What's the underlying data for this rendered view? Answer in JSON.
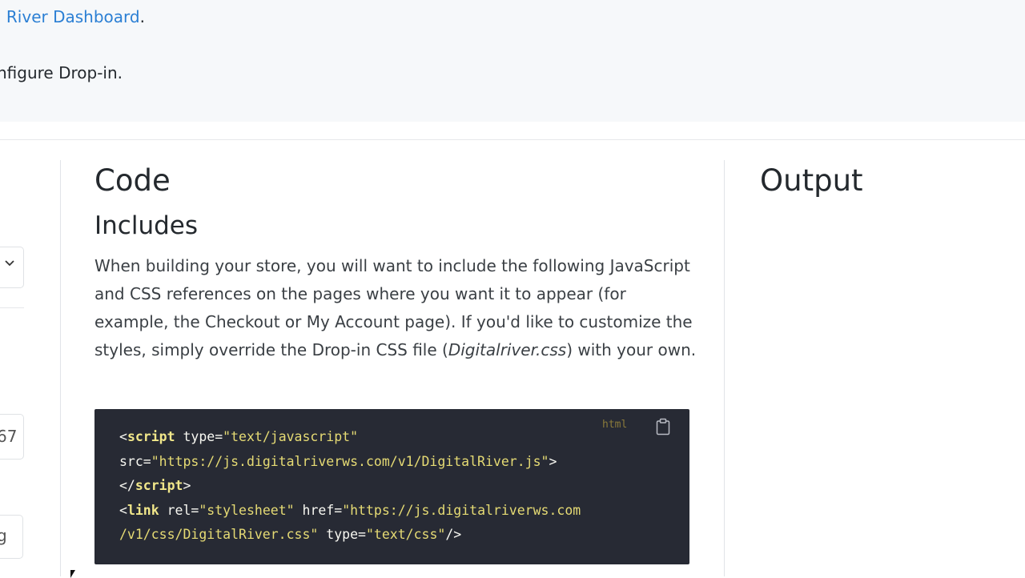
{
  "top": {
    "link_text": "l River Dashboard",
    "link_suffix": ".",
    "line2": "nfigure Drop-in."
  },
  "left_controls": {
    "fragment_a": "67",
    "fragment_b": "g"
  },
  "code_panel": {
    "heading": "Code",
    "subheading": "Includes",
    "para_before": "When building your store, you will want to include the following JavaScript and CSS references on the pages where you want it to appear (for example, the Checkout or My Account page). If you'd like to customize the styles, simply override the Drop-in CSS file (",
    "para_em": "Digitalriver.css",
    "para_after": ") with your own.",
    "code_lang": "html",
    "code": {
      "l1_open": "<",
      "l1_tag": "script",
      "l1_attr": " type=",
      "l1_val": "\"text/javascript\"",
      "l2_attr": "src=",
      "l2_val": "\"https://js.digitalriverws.com/v1/DigitalRiver.js\"",
      "l2_close": ">",
      "l3_open": "</",
      "l3_tag": "script",
      "l3_close": ">",
      "l4_open": "<",
      "l4_tag": "link",
      "l4_attr1": " rel=",
      "l4_val1": "\"stylesheet\"",
      "l4_attr2": " href=",
      "l4_val2": "\"https://js.digitalriverws.com",
      "l5_val2": "/v1/css/DigitalRiver.css\"",
      "l5_attr3": " type=",
      "l5_val3": "\"text/css\"",
      "l5_close": "/>"
    }
  },
  "output_panel": {
    "heading": "Output"
  },
  "icons": {
    "copy": "clipboard-icon",
    "select": "chevron-down-icon"
  }
}
